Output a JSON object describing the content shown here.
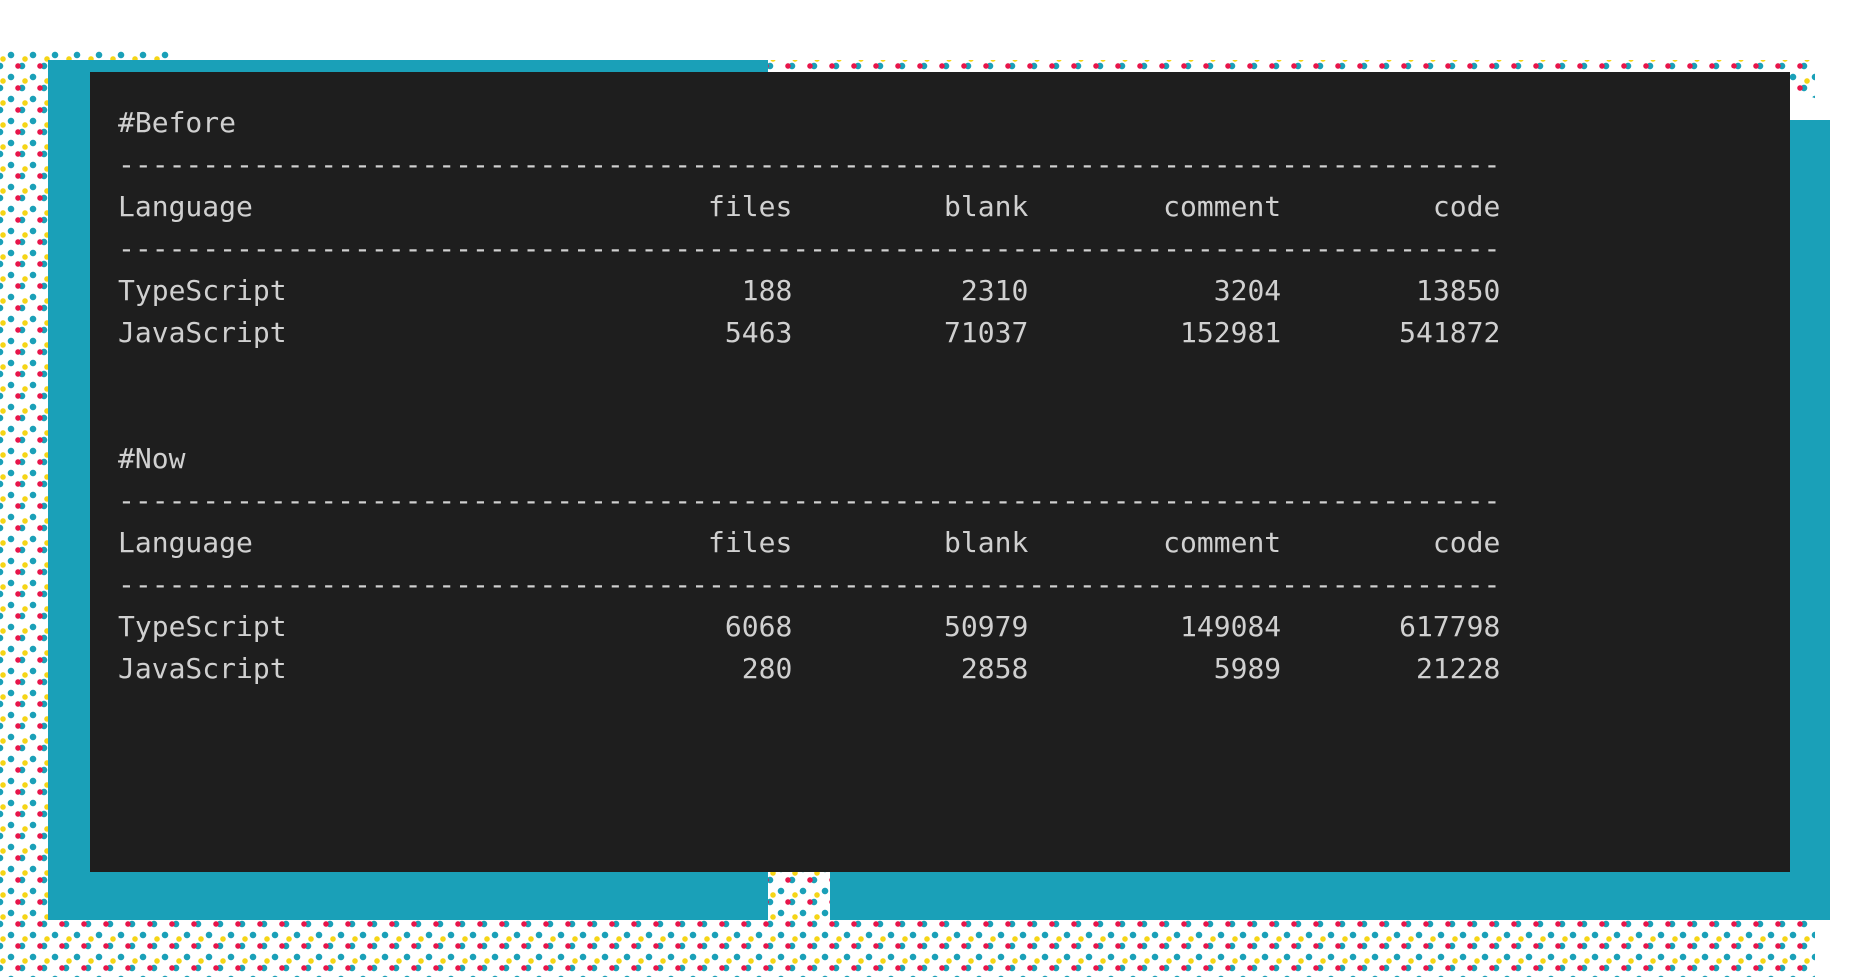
{
  "sections": [
    {
      "title": "#Before",
      "headers": [
        "Language",
        "files",
        "blank",
        "comment",
        "code"
      ],
      "rows": [
        {
          "language": "TypeScript",
          "files": 188,
          "blank": 2310,
          "comment": 3204,
          "code": 13850
        },
        {
          "language": "JavaScript",
          "files": 5463,
          "blank": 71037,
          "comment": 152981,
          "code": 541872
        }
      ]
    },
    {
      "title": "#Now",
      "headers": [
        "Language",
        "files",
        "blank",
        "comment",
        "code"
      ],
      "rows": [
        {
          "language": "TypeScript",
          "files": 6068,
          "blank": 50979,
          "comment": 149084,
          "code": 617798
        },
        {
          "language": "JavaScript",
          "files": 280,
          "blank": 2858,
          "comment": 5989,
          "code": 21228
        }
      ]
    }
  ],
  "col_widths": {
    "language": 32,
    "files": 8,
    "blank": 14,
    "comment": 15,
    "code": 13
  },
  "divider_char": "-",
  "divider_length": 82,
  "chart_data": [
    {
      "type": "table",
      "title": "#Before",
      "columns": [
        "Language",
        "files",
        "blank",
        "comment",
        "code"
      ],
      "rows": [
        [
          "TypeScript",
          188,
          2310,
          3204,
          13850
        ],
        [
          "JavaScript",
          5463,
          71037,
          152981,
          541872
        ]
      ]
    },
    {
      "type": "table",
      "title": "#Now",
      "columns": [
        "Language",
        "files",
        "blank",
        "comment",
        "code"
      ],
      "rows": [
        [
          "TypeScript",
          6068,
          50979,
          149084,
          617798
        ],
        [
          "JavaScript",
          280,
          2858,
          5989,
          21228
        ]
      ]
    }
  ]
}
